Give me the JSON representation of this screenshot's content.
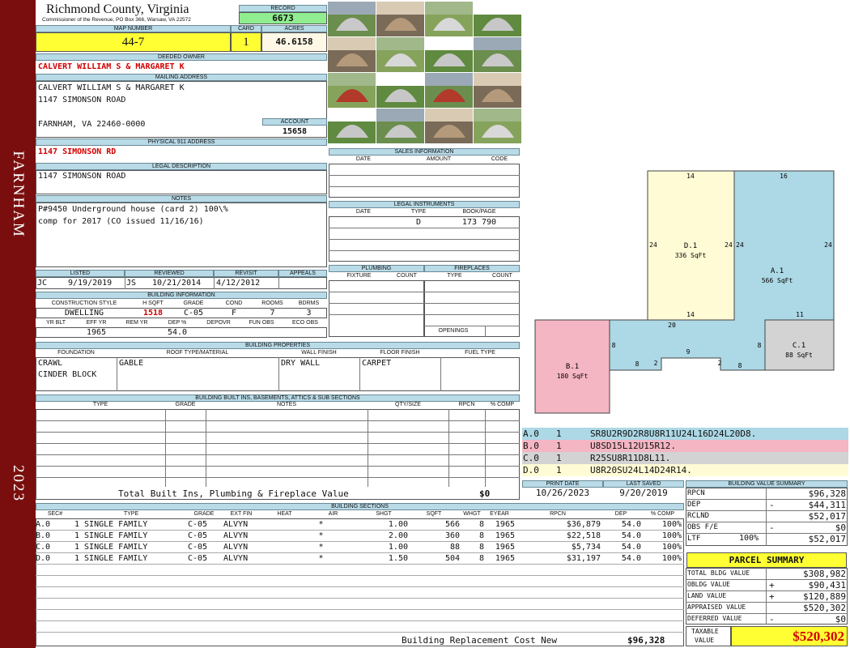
{
  "side": {
    "city": "FARNHAM",
    "year": "2023"
  },
  "header": {
    "county": "Richmond County, Virginia",
    "commissioner": "Commissioner of the Revenue, PO Box 366, Warsaw, VA 22572",
    "record_label": "RECORD",
    "record": "6673"
  },
  "map": {
    "map_label": "MAP NUMBER",
    "map_number": "44-7",
    "card_label": "CARD",
    "card": "1",
    "acres_label": "ACRES",
    "acres": "46.6158"
  },
  "owner": {
    "label": "DEEDED OWNER",
    "name": "CALVERT WILLIAM S & MARGARET K"
  },
  "mailing": {
    "label": "MAILING ADDRESS",
    "line1": "CALVERT WILLIAM S & MARGARET K",
    "line2": "1147 SIMONSON ROAD",
    "line3": "FARNHAM, VA 22460-0000",
    "account_label": "ACCOUNT",
    "account": "15658"
  },
  "physical": {
    "label": "PHYSICAL 911 ADDRESS",
    "address": "1147 SIMONSON RD"
  },
  "legal": {
    "label": "LEGAL DESCRIPTION",
    "text": "1147 SIMONSON ROAD"
  },
  "notes": {
    "label": "NOTES",
    "line1": "P#9450 Underground house (card 2) 100\\%",
    "line2": "comp for 2017 (CO issued 11/16/16)"
  },
  "review": {
    "listed_label": "LISTED",
    "listed_by": "JC",
    "listed_date": "9/19/2019",
    "reviewed_label": "REVIEWED",
    "reviewed_by": "JS",
    "reviewed_date": "10/21/2014",
    "revisit_label": "REVISIT",
    "revisit_date": "4/12/2012",
    "appeals_label": "APPEALS"
  },
  "building_info": {
    "label": "BUILDING INFORMATION",
    "headers": [
      "CONSTRUCTION STYLE",
      "H SQFT",
      "GRADE",
      "COND",
      "ROOMS",
      "BDRMS"
    ],
    "style": "DWELLING",
    "hsqft": "1518",
    "grade": "C-05",
    "cond": "F",
    "rooms": "7",
    "bdrms": "3",
    "headers2": [
      "YR BLT",
      "EFF YR",
      "REM YR",
      "DEP %",
      "DEPOVR",
      "FUN OBS",
      "ECO OBS"
    ],
    "eff_yr": "1965",
    "dep": "54.0"
  },
  "sales": {
    "label": "SALES INFORMATION",
    "headers": [
      "DATE",
      "AMOUNT",
      "CODE"
    ]
  },
  "instruments": {
    "label": "LEGAL INSTRUMENTS",
    "headers": [
      "DATE",
      "TYPE",
      "BOOK/PAGE"
    ],
    "type": "D",
    "bookpage": "173 790"
  },
  "plumbing": {
    "label": "PLUMBING",
    "headers": [
      "FIXTURE",
      "COUNT"
    ]
  },
  "fireplaces": {
    "label": "FIREPLACES",
    "headers": [
      "TYPE",
      "COUNT"
    ],
    "openings": "OPENINGS"
  },
  "props": {
    "label": "BUILDING PROPERTIES",
    "headers": [
      "FOUNDATION",
      "ROOF TYPE/MATERIAL",
      "WALL FINISH",
      "FLOOR FINISH",
      "FUEL TYPE"
    ],
    "foundation1": "CRAWL",
    "foundation2": "CINDER BLOCK",
    "roof": "GABLE",
    "wall": "DRY WALL",
    "floor": "CARPET"
  },
  "builtins": {
    "label": "BUILDING BUILT INS, BASEMENTS, ATTICS & SUB SECTIONS",
    "headers": [
      "TYPE",
      "GRADE",
      "NOTES",
      "QTY/SIZE",
      "RPCN",
      "% COMP"
    ],
    "total_label": "Total Built Ins, Plumbing & Fireplace Value",
    "total": "$0"
  },
  "print": {
    "print_label": "PRINT DATE",
    "print_date": "10/26/2023",
    "saved_label": "LAST SAVED",
    "saved_date": "9/20/2019"
  },
  "sections": {
    "label": "BUILDING SECTIONS",
    "headers": [
      "SEC#",
      "TYPE",
      "GRADE",
      "EXT FIN",
      "HEAT",
      "AIR",
      "SHGT",
      "SQFT",
      "WHGT",
      "EYEAR",
      "RPCN",
      "DEP",
      "% COMP"
    ],
    "rows": [
      {
        "sec": "A.0",
        "type": "1 SINGLE FAMILY",
        "grade": "C-05",
        "ext": "ALVYN",
        "air": "*",
        "shgt": "1.00",
        "sqft": "566",
        "whgt": "8",
        "eyear": "1965",
        "rpcn": "$36,879",
        "dep": "54.0",
        "comp": "100%"
      },
      {
        "sec": "B.0",
        "type": "1 SINGLE FAMILY",
        "grade": "C-05",
        "ext": "ALVYN",
        "air": "*",
        "shgt": "2.00",
        "sqft": "360",
        "whgt": "8",
        "eyear": "1965",
        "rpcn": "$22,518",
        "dep": "54.0",
        "comp": "100%"
      },
      {
        "sec": "C.0",
        "type": "1 SINGLE FAMILY",
        "grade": "C-05",
        "ext": "ALVYN",
        "air": "*",
        "shgt": "1.00",
        "sqft": "88",
        "whgt": "8",
        "eyear": "1965",
        "rpcn": "$5,734",
        "dep": "54.0",
        "comp": "100%"
      },
      {
        "sec": "D.0",
        "type": "1 SINGLE FAMILY",
        "grade": "C-05",
        "ext": "ALVYN",
        "air": "*",
        "shgt": "1.50",
        "sqft": "504",
        "whgt": "8",
        "eyear": "1965",
        "rpcn": "$31,197",
        "dep": "54.0",
        "comp": "100%"
      }
    ],
    "replacement_label": "Building Replacement Cost New",
    "replacement": "$96,328"
  },
  "sketch": {
    "d_label": "D.1",
    "d_area": "336 SqFt",
    "a_label": "A.1",
    "a_area": "566 SqFt",
    "b_label": "B.1",
    "b_area": "180 SqFt",
    "c_label": "C.1",
    "c_area": "88 SqFt",
    "dims": [
      "14",
      "16",
      "24",
      "24",
      "24",
      "24",
      "14",
      "11",
      "20",
      "8",
      "8",
      "9",
      "8",
      "2",
      "2",
      "8"
    ],
    "colors": {
      "a": "#add8e6",
      "b": "#f4b6c2",
      "c": "#d3d3d3",
      "d": "#fffbd5"
    }
  },
  "legend": [
    {
      "code": "A.0",
      "n": "1",
      "path": "SR8U2R9D2R8U8R11U24L16D24L20D8."
    },
    {
      "code": "B.0",
      "n": "1",
      "path": "U8SD15L12U15R12."
    },
    {
      "code": "C.0",
      "n": "1",
      "path": "R25SU8R11D8L11."
    },
    {
      "code": "D.0",
      "n": "1",
      "path": "U8R20SU24L14D24R14."
    }
  ],
  "value_summary": {
    "label": "BUILDING VALUE SUMMARY",
    "rpcn_label": "RPCN",
    "rpcn": "$96,328",
    "dep_label": "DEP",
    "dep_sign": "-",
    "dep": "$44,311",
    "rclnd_label": "RCLND",
    "rclnd": "$52,017",
    "obs_label": "OBS F/E",
    "obs_sign": "-",
    "obs": "$0",
    "ltf_label": "LTF",
    "ltf_pct": "100%",
    "ltf": "$52,017"
  },
  "parcel": {
    "title": "PARCEL SUMMARY",
    "total_bldg_label": "TOTAL BLDG VALUE",
    "total_bldg": "$308,982",
    "obldg_label": "OBLDG VALUE",
    "obldg_sign": "+",
    "obldg": "$90,431",
    "land_label": "LAND VALUE",
    "land_sign": "+",
    "land": "$120,889",
    "appraised_label": "APPRAISED VALUE",
    "appraised": "$520,302",
    "deferred_label": "DEFERRED VALUE",
    "deferred_sign": "-",
    "deferred": "$0",
    "taxable_label1": "TAXABLE",
    "taxable_label2": "VALUE",
    "taxable": "$520,302"
  }
}
